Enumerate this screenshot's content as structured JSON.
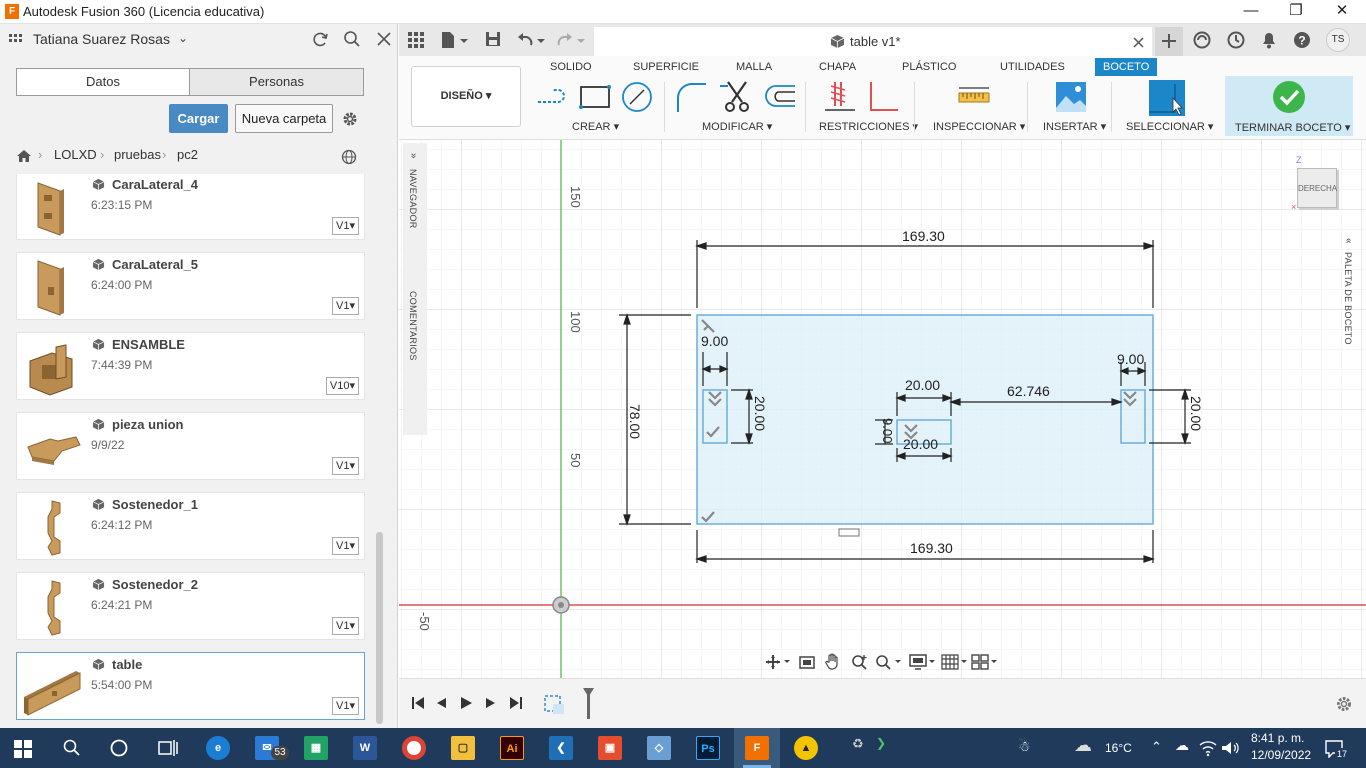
{
  "window": {
    "title": "Autodesk Fusion 360 (Licencia educativa)",
    "app_icon": "F"
  },
  "data_panel": {
    "user": "Tatiana Suarez Rosas",
    "tabs": [
      "Datos",
      "Personas"
    ],
    "upload_label": "Cargar",
    "new_folder_label": "Nueva carpeta",
    "breadcrumb": [
      "LOLXD",
      "pruebas",
      "pc2"
    ],
    "files": [
      {
        "name": "CaraLateral_4",
        "time": "6:23:15 PM",
        "version": "V1"
      },
      {
        "name": "CaraLateral_5",
        "time": "6:24:00 PM",
        "version": "V1"
      },
      {
        "name": "ENSAMBLE",
        "time": "7:44:39 PM",
        "version": "V10"
      },
      {
        "name": "pieza union",
        "time": "9/9/22",
        "version": "V1"
      },
      {
        "name": "Sostenedor_1",
        "time": "6:24:12 PM",
        "version": "V1"
      },
      {
        "name": "Sostenedor_2",
        "time": "6:24:21 PM",
        "version": "V1"
      },
      {
        "name": "table",
        "time": "5:54:00 PM",
        "version": "V1"
      }
    ]
  },
  "document": {
    "title": "table v1*",
    "user_initials": "TS"
  },
  "toolbar": {
    "design_label": "DISEÑO",
    "workspace_tabs": [
      "SOLIDO",
      "SUPERFICIE",
      "MALLA",
      "CHAPA",
      "PLÁSTICO",
      "UTILIDADES",
      "BOCETO"
    ],
    "groups": [
      "CREAR",
      "MODIFICAR",
      "RESTRICCIONES",
      "INSPECCIONAR",
      "INSERTAR",
      "SELECCIONAR",
      "TERMINAR BOCETO"
    ]
  },
  "side_labels": {
    "navigator": "NAVEGADOR",
    "comments": "COMENTARIOS",
    "palette": "PALETA DE BOCETO"
  },
  "viewcube": {
    "face": "DERECHA",
    "axis": "Z"
  },
  "canvas": {
    "ruler_labels": [
      "150",
      "100",
      "50",
      "-50"
    ],
    "dimensions": [
      "169.30",
      "169.30",
      "78.00",
      "9.00",
      "20.00",
      "20.00",
      "62.746",
      "9.00",
      "20.00",
      "9.00",
      "20.00"
    ]
  },
  "taskbar": {
    "temp": "16°C",
    "time": "8:41 p. m.",
    "date": "12/09/2022",
    "mail_badge": "53",
    "notif_badge": "17"
  },
  "colors": {
    "accent": "#1b87c9",
    "sketch_fill": "#dbedf8",
    "x_axis": "#e05050",
    "y_axis": "#6cc36c",
    "taskbar": "#1f3a5a"
  }
}
